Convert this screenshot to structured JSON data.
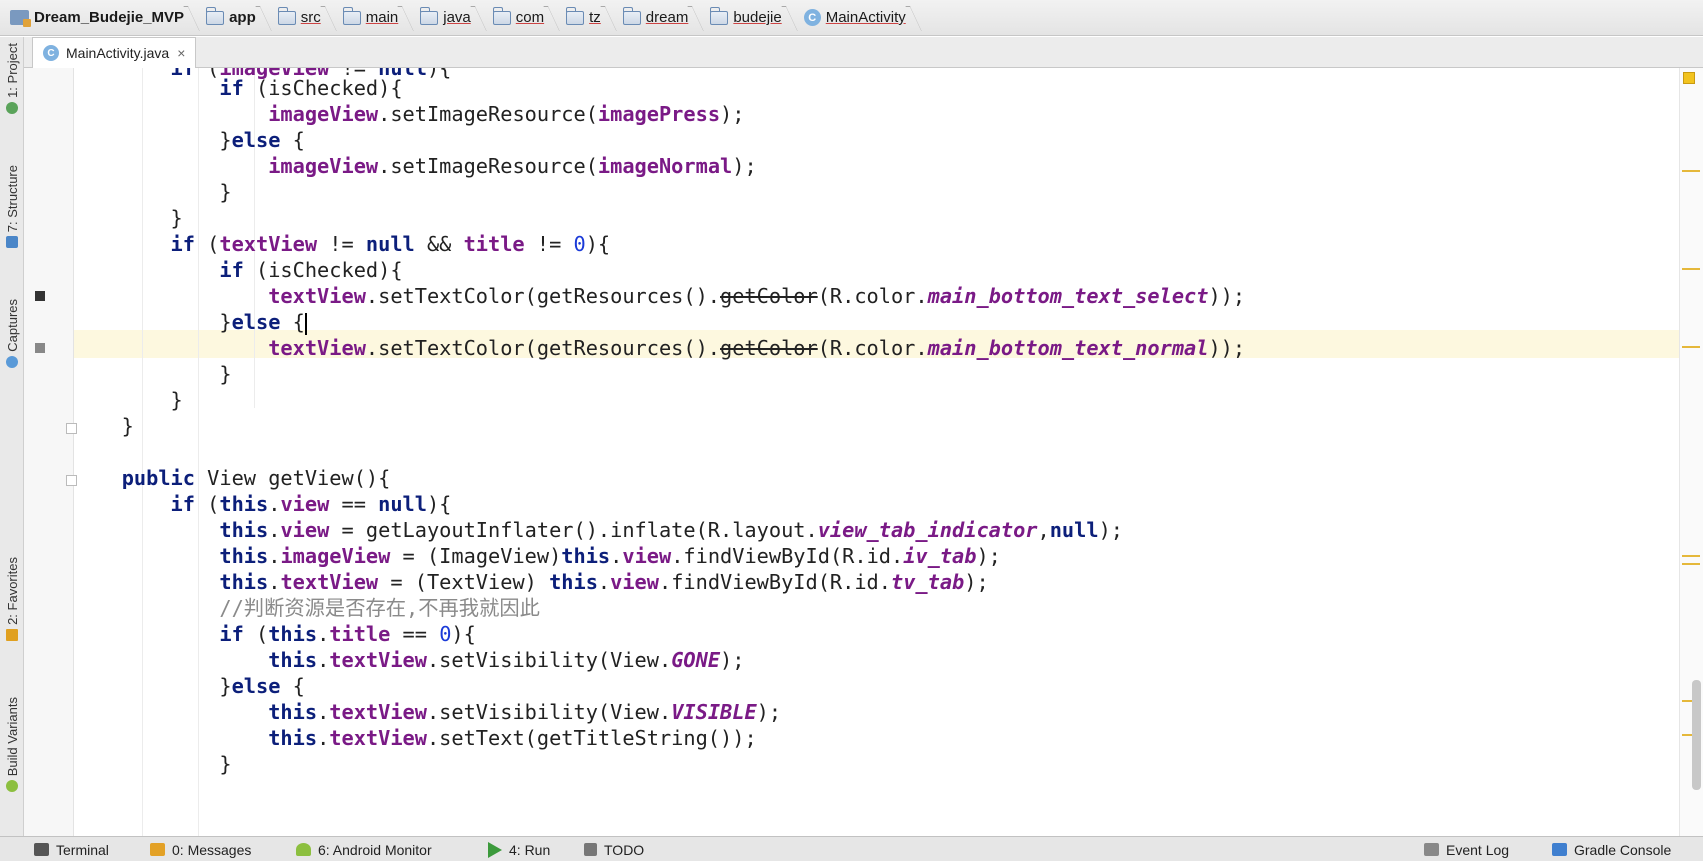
{
  "breadcrumb": [
    "Dream_Budejie_MVP",
    "app",
    "src",
    "main",
    "java",
    "com",
    "tz",
    "dream",
    "budejie",
    "MainActivity"
  ],
  "tab": {
    "label": "MainActivity.java",
    "close": "×",
    "class_glyph": "C"
  },
  "left_tools": {
    "project": "1: Project",
    "structure": "7: Structure",
    "captures": "Captures",
    "favorites": "2: Favorites",
    "build_variants": "Build Variants"
  },
  "code_lines": [
    "            if (imageView != null){",
    "                if (isChecked){",
    "                    imageView.setImageResource(imagePress);",
    "                }else {",
    "                    imageView.setImageResource(imageNormal);",
    "                }",
    "            }",
    "            if (textView != null && title != 0){",
    "                if (isChecked){",
    "                    textView.setTextColor(getResources().getColor(R.color.main_bottom_text_select));",
    "                }else {",
    "                    textView.setTextColor(getResources().getColor(R.color.main_bottom_text_normal));",
    "                }",
    "            }",
    "        }",
    "",
    "        public View getView(){",
    "            if (this.view == null){",
    "                this.view = getLayoutInflater().inflate(R.layout.view_tab_indicator,null);",
    "                this.imageView = (ImageView)this.view.findViewById(R.id.iv_tab);",
    "                this.textView = (TextView) this.view.findViewById(R.id.tv_tab);",
    "                //判断资源是否存在,不再我就因此",
    "                if (this.title == 0){",
    "                    this.textView.setVisibility(View.GONE);",
    "                }else {",
    "                    this.textView.setVisibility(View.VISIBLE);",
    "                    this.textView.setText(getTitleString());",
    "                }"
  ],
  "status_bar": {
    "terminal": "Terminal",
    "messages": "0: Messages",
    "android_monitor": "6: Android Monitor",
    "run": "4: Run",
    "todo": "TODO",
    "event_log": "Event Log",
    "gradle_console": "Gradle Console"
  },
  "colors": {
    "keyword": "#0c1f7a",
    "field": "#7a1a86",
    "number": "#1a3ad8",
    "comment": "#8a8a8a",
    "caret_line": "#fdf8df"
  }
}
